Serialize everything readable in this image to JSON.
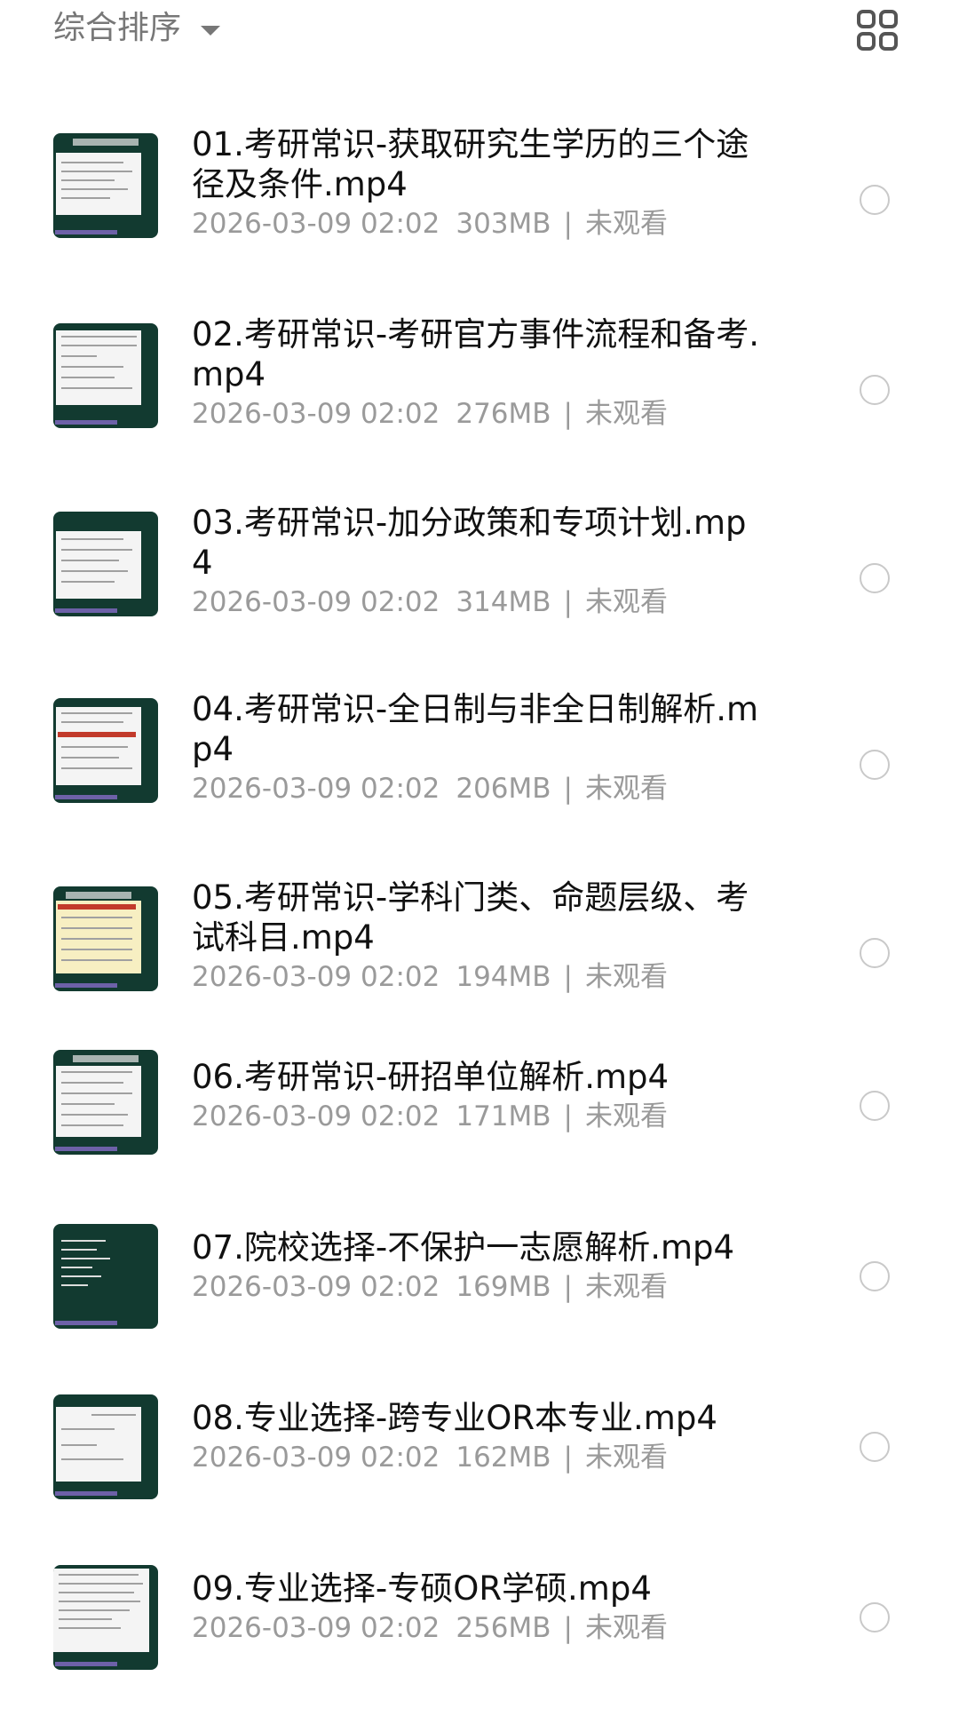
{
  "header": {
    "sort_label": "综合排序",
    "sort_icon": "caret-down-icon",
    "view_toggle_icon": "grid-view-icon"
  },
  "files": [
    {
      "title": "01.考研常识-获取研究生学历的三个途径及条件.mp4",
      "date": "2026-03-09 02:02",
      "size": "303MB",
      "status": "未观看"
    },
    {
      "title": "02.考研常识-考研官方事件流程和备考.mp4",
      "date": "2026-03-09 02:02",
      "size": "276MB",
      "status": "未观看"
    },
    {
      "title": "03.考研常识-加分政策和专项计划.mp4",
      "date": "2026-03-09 02:02",
      "size": "314MB",
      "status": "未观看"
    },
    {
      "title": "04.考研常识-全日制与非全日制解析.mp4",
      "date": "2026-03-09 02:02",
      "size": "206MB",
      "status": "未观看"
    },
    {
      "title": "05.考研常识-学科门类、命题层级、考试科目.mp4",
      "date": "2026-03-09 02:02",
      "size": "194MB",
      "status": "未观看"
    },
    {
      "title": "06.考研常识-研招单位解析.mp4",
      "date": "2026-03-09 02:02",
      "size": "171MB",
      "status": "未观看"
    },
    {
      "title": "07.院校选择-不保护一志愿解析.mp4",
      "date": "2026-03-09 02:02",
      "size": "169MB",
      "status": "未观看"
    },
    {
      "title": "08.专业选择-跨专业OR本专业.mp4",
      "date": "2026-03-09 02:02",
      "size": "162MB",
      "status": "未观看"
    },
    {
      "title": "09.专业选择-专硕OR学硕.mp4",
      "date": "2026-03-09 02:02",
      "size": "256MB",
      "status": "未观看"
    }
  ],
  "colors": {
    "thumb_bg": "#123a30",
    "meta_text": "#9a9a9a",
    "radio_border": "#c9c9c9"
  }
}
